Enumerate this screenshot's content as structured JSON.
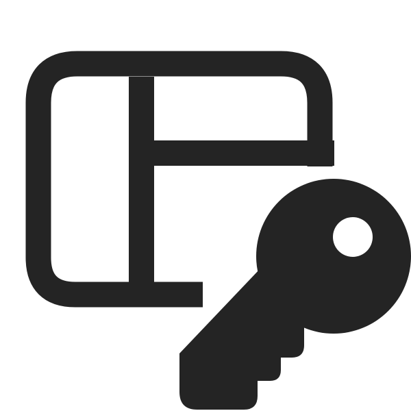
{
  "icon": {
    "name": "table-lock-key-icon",
    "color": "#242424",
    "background": "#ffffff"
  }
}
